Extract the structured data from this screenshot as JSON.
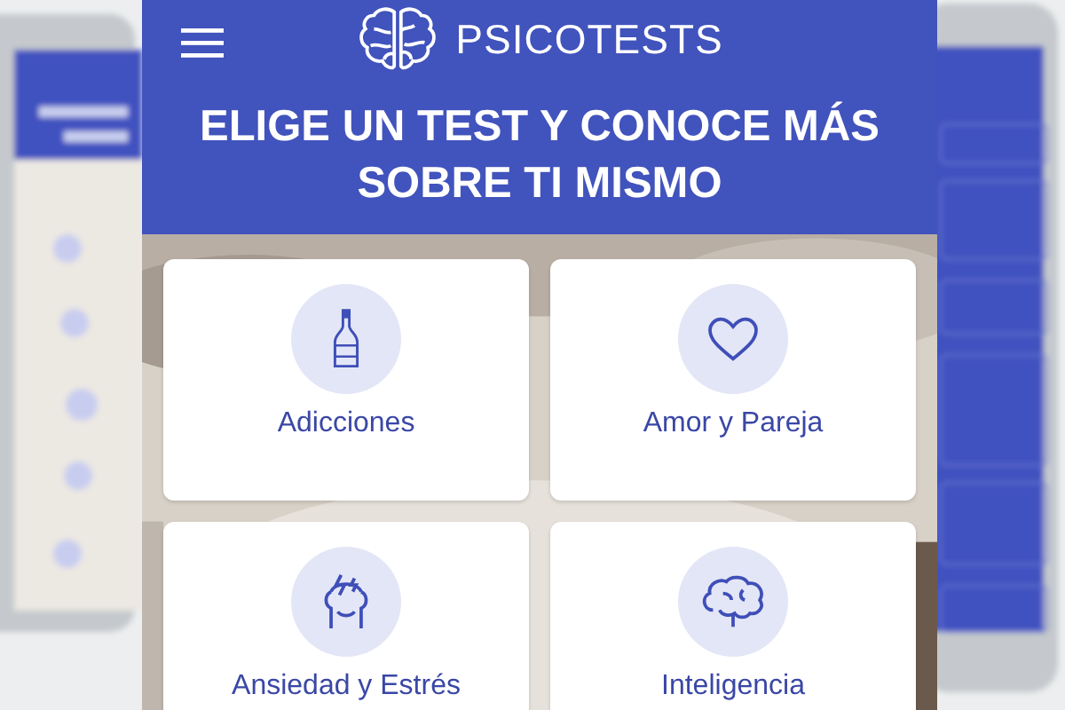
{
  "app": {
    "brand": "PSICOTESTS",
    "headline": "ELIGE UN TEST Y CONOCE MÁS SOBRE TI MISMO"
  },
  "tests": [
    {
      "label": "Adicciones",
      "kind": "bottle"
    },
    {
      "label": "Amor y Pareja",
      "kind": "heart"
    },
    {
      "label": "Ansiedad y Estrés",
      "kind": "head"
    },
    {
      "label": "Inteligencia",
      "kind": "brain"
    }
  ]
}
